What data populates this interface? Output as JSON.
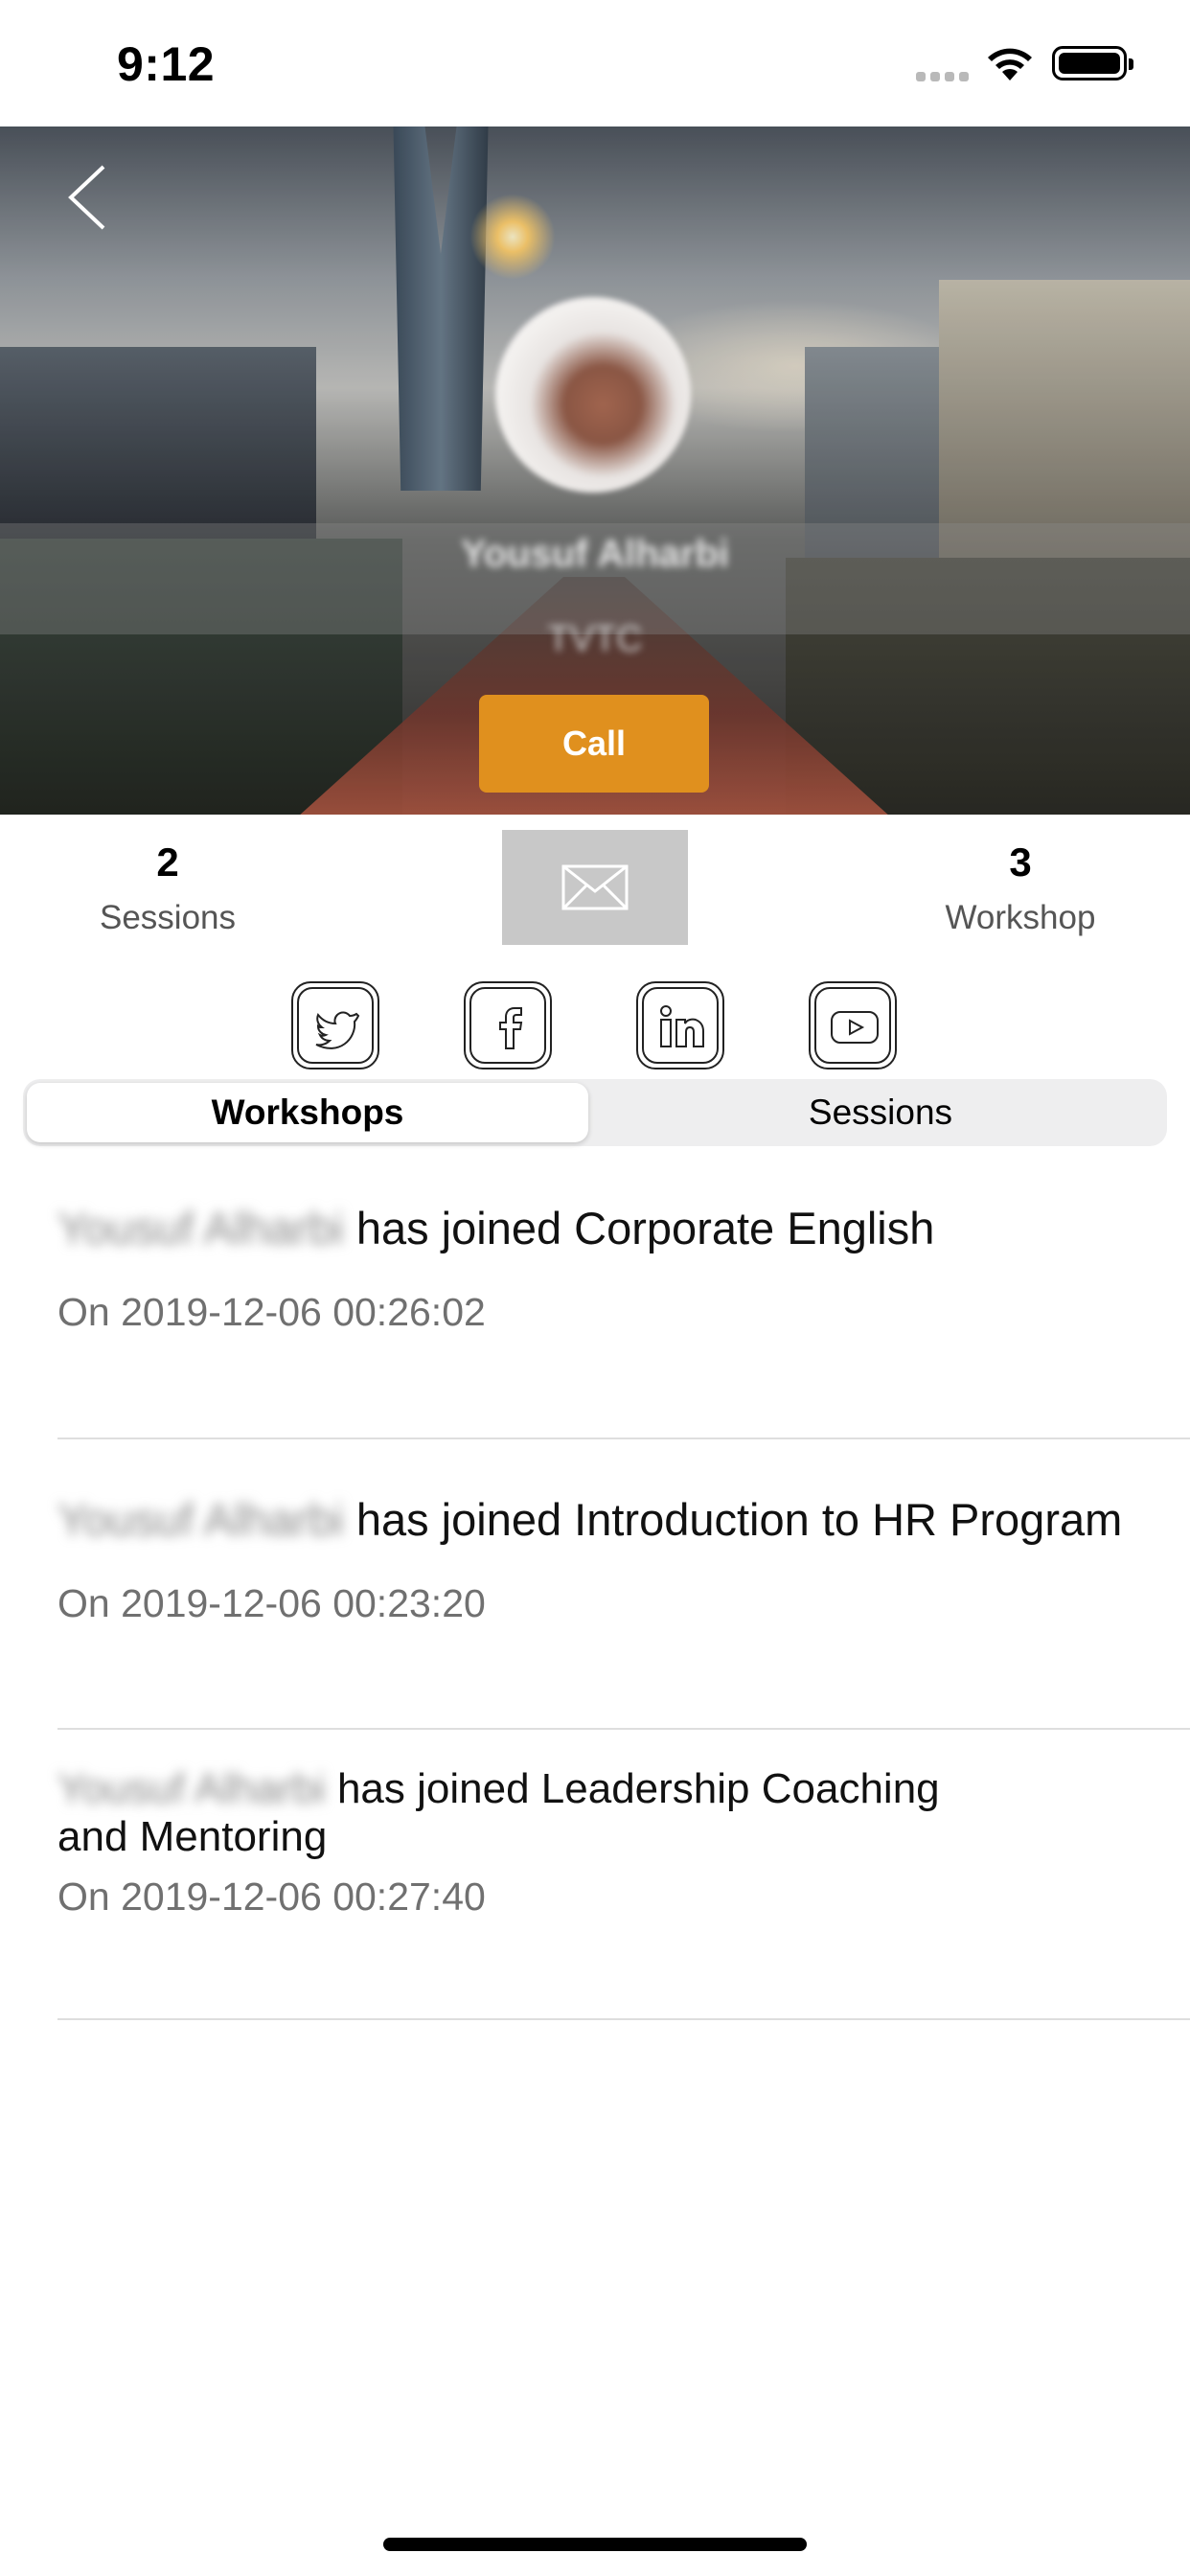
{
  "status_bar": {
    "time": "9:12"
  },
  "profile": {
    "name": "Yousuf Alharbi",
    "organization": "TVTC",
    "call_label": "Call"
  },
  "stats": {
    "sessions": {
      "value": "2",
      "label": "Sessions"
    },
    "workshop": {
      "value": "3",
      "label": "Workshop"
    }
  },
  "social_icons": [
    "twitter-icon",
    "facebook-icon",
    "linkedin-icon",
    "youtube-icon"
  ],
  "tabs": [
    {
      "label": "Workshops",
      "selected": true
    },
    {
      "label": "Sessions",
      "selected": false
    }
  ],
  "activities": [
    {
      "name": "Yousuf Alharbi",
      "text_line1": "has joined Corporate English",
      "text_line2": "",
      "date": "On 2019-12-06 00:26:02"
    },
    {
      "name": "Yousuf Alharbi",
      "text_line1": "has joined Introduction to HR Program",
      "text_line2": "",
      "date": "On 2019-12-06 00:23:20"
    },
    {
      "name": "Yousuf Alharbi",
      "text_line1": "has joined Leadership Coaching",
      "text_line2": "and Mentoring",
      "date": "On 2019-12-06 00:27:40"
    }
  ],
  "colors": {
    "accent": "#E0901E",
    "mail_button_bg": "#C8C8C8",
    "divider": "#DEDEDE"
  }
}
